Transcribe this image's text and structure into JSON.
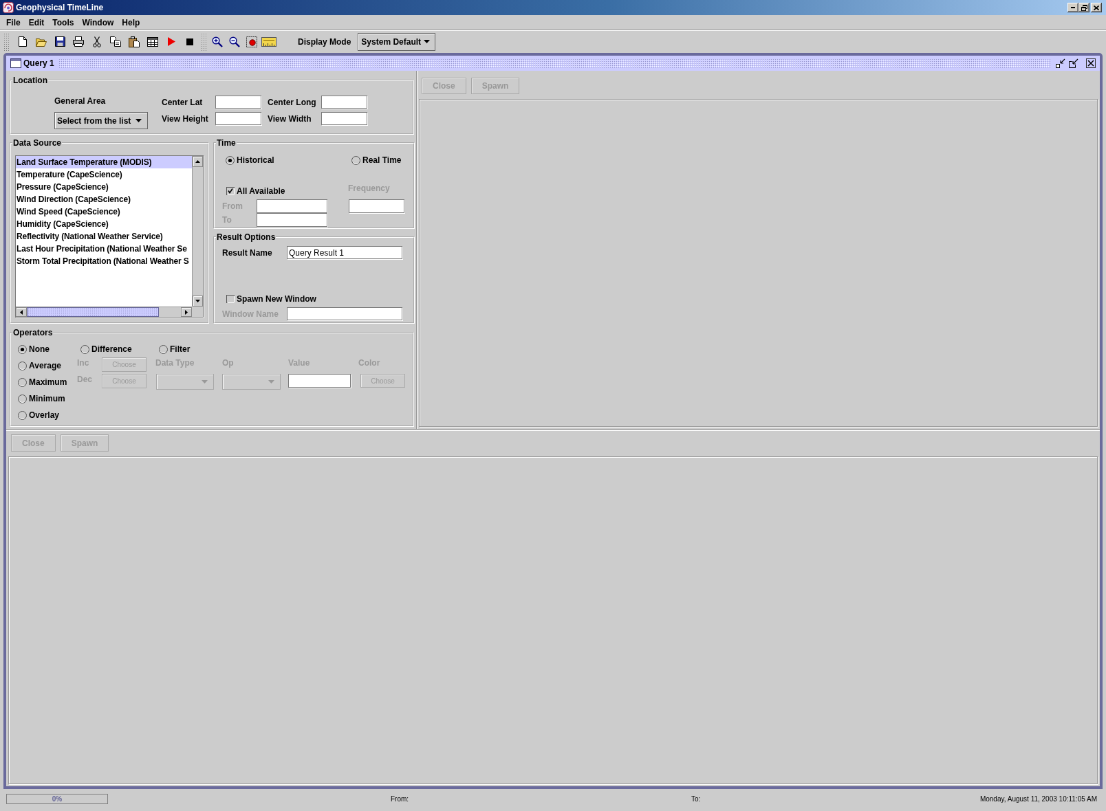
{
  "window": {
    "title": "Geophysical TimeLine"
  },
  "menu": [
    {
      "label": "File"
    },
    {
      "label": "Edit"
    },
    {
      "label": "Tools"
    },
    {
      "label": "Window"
    },
    {
      "label": "Help"
    }
  ],
  "toolbar": {
    "display_mode": {
      "label": "Display Mode",
      "value": "System Default"
    }
  },
  "query_window": {
    "title": "Query 1",
    "location": {
      "title": "Location",
      "general_area": {
        "label": "General Area",
        "value": "Select from the list"
      },
      "fields": [
        {
          "label": "Center Lat"
        },
        {
          "label": "Center Long"
        },
        {
          "label": "View Height"
        },
        {
          "label": "View Width"
        }
      ]
    },
    "data_source": {
      "title": "Data Source",
      "items": [
        {
          "label": "Land Surface Temperature (MODIS)",
          "selected": true
        },
        {
          "label": "Temperature (CapeScience)",
          "selected": false
        },
        {
          "label": "Pressure (CapeScience)",
          "selected": false
        },
        {
          "label": "Wind Direction (CapeScience)",
          "selected": false
        },
        {
          "label": "Wind Speed (CapeScience)",
          "selected": false
        },
        {
          "label": "Humidity (CapeScience)",
          "selected": false
        },
        {
          "label": "Reflectivity (National Weather Service)",
          "selected": false
        },
        {
          "label": "Last Hour Precipitation (National Weather Se",
          "selected": false
        },
        {
          "label": "Storm Total Precipitation (National Weather S",
          "selected": false
        }
      ]
    },
    "time": {
      "title": "Time",
      "modes": [
        {
          "label": "Historical",
          "selected": true
        },
        {
          "label": "Real Time",
          "selected": false
        }
      ],
      "all_available": {
        "label": "All Available",
        "checked": true
      },
      "frequency": {
        "label": "Frequency",
        "disabled": true
      },
      "range": [
        {
          "label": "From",
          "disabled": true
        },
        {
          "label": "To",
          "disabled": true
        }
      ]
    },
    "result_options": {
      "title": "Result Options",
      "result_name": {
        "label": "Result Name",
        "value": "Query Result 1"
      },
      "spawn_new_window": {
        "label": "Spawn New Window",
        "checked": false
      },
      "window_name": {
        "label": "Window Name",
        "disabled": true
      }
    },
    "operators": {
      "title": "Operators",
      "options": [
        {
          "label": "None",
          "selected": true
        },
        {
          "label": "Average",
          "selected": false
        },
        {
          "label": "Maximum",
          "selected": false
        },
        {
          "label": "Minimum",
          "selected": false
        },
        {
          "label": "Overlay",
          "selected": false
        }
      ],
      "difference": {
        "label": "Difference",
        "selected": false,
        "rows": [
          {
            "label": "Inc",
            "button": "Choose",
            "disabled": true
          },
          {
            "label": "Dec",
            "button": "Choose",
            "disabled": true
          }
        ]
      },
      "filter": {
        "label": "Filter",
        "selected": false,
        "data_type": {
          "label": "Data Type",
          "disabled": true
        },
        "op": {
          "label": "Op",
          "disabled": true
        },
        "value": {
          "label": "Value",
          "disabled": true
        },
        "color": {
          "label": "Color",
          "button": "Choose",
          "disabled": true
        }
      }
    },
    "right_pane": {
      "buttons": [
        {
          "label": "Close",
          "disabled": true
        },
        {
          "label": "Spawn",
          "disabled": true
        }
      ]
    },
    "bottom_pane": {
      "buttons": [
        {
          "label": "Close",
          "disabled": true
        },
        {
          "label": "Spawn",
          "disabled": true
        }
      ]
    }
  },
  "status_bar": {
    "progress": {
      "level": 0,
      "reading": "0%"
    },
    "from_label": "From:",
    "to_label": "To:",
    "timestamp": "Monday, August 11, 2003 10:11:05 AM"
  }
}
